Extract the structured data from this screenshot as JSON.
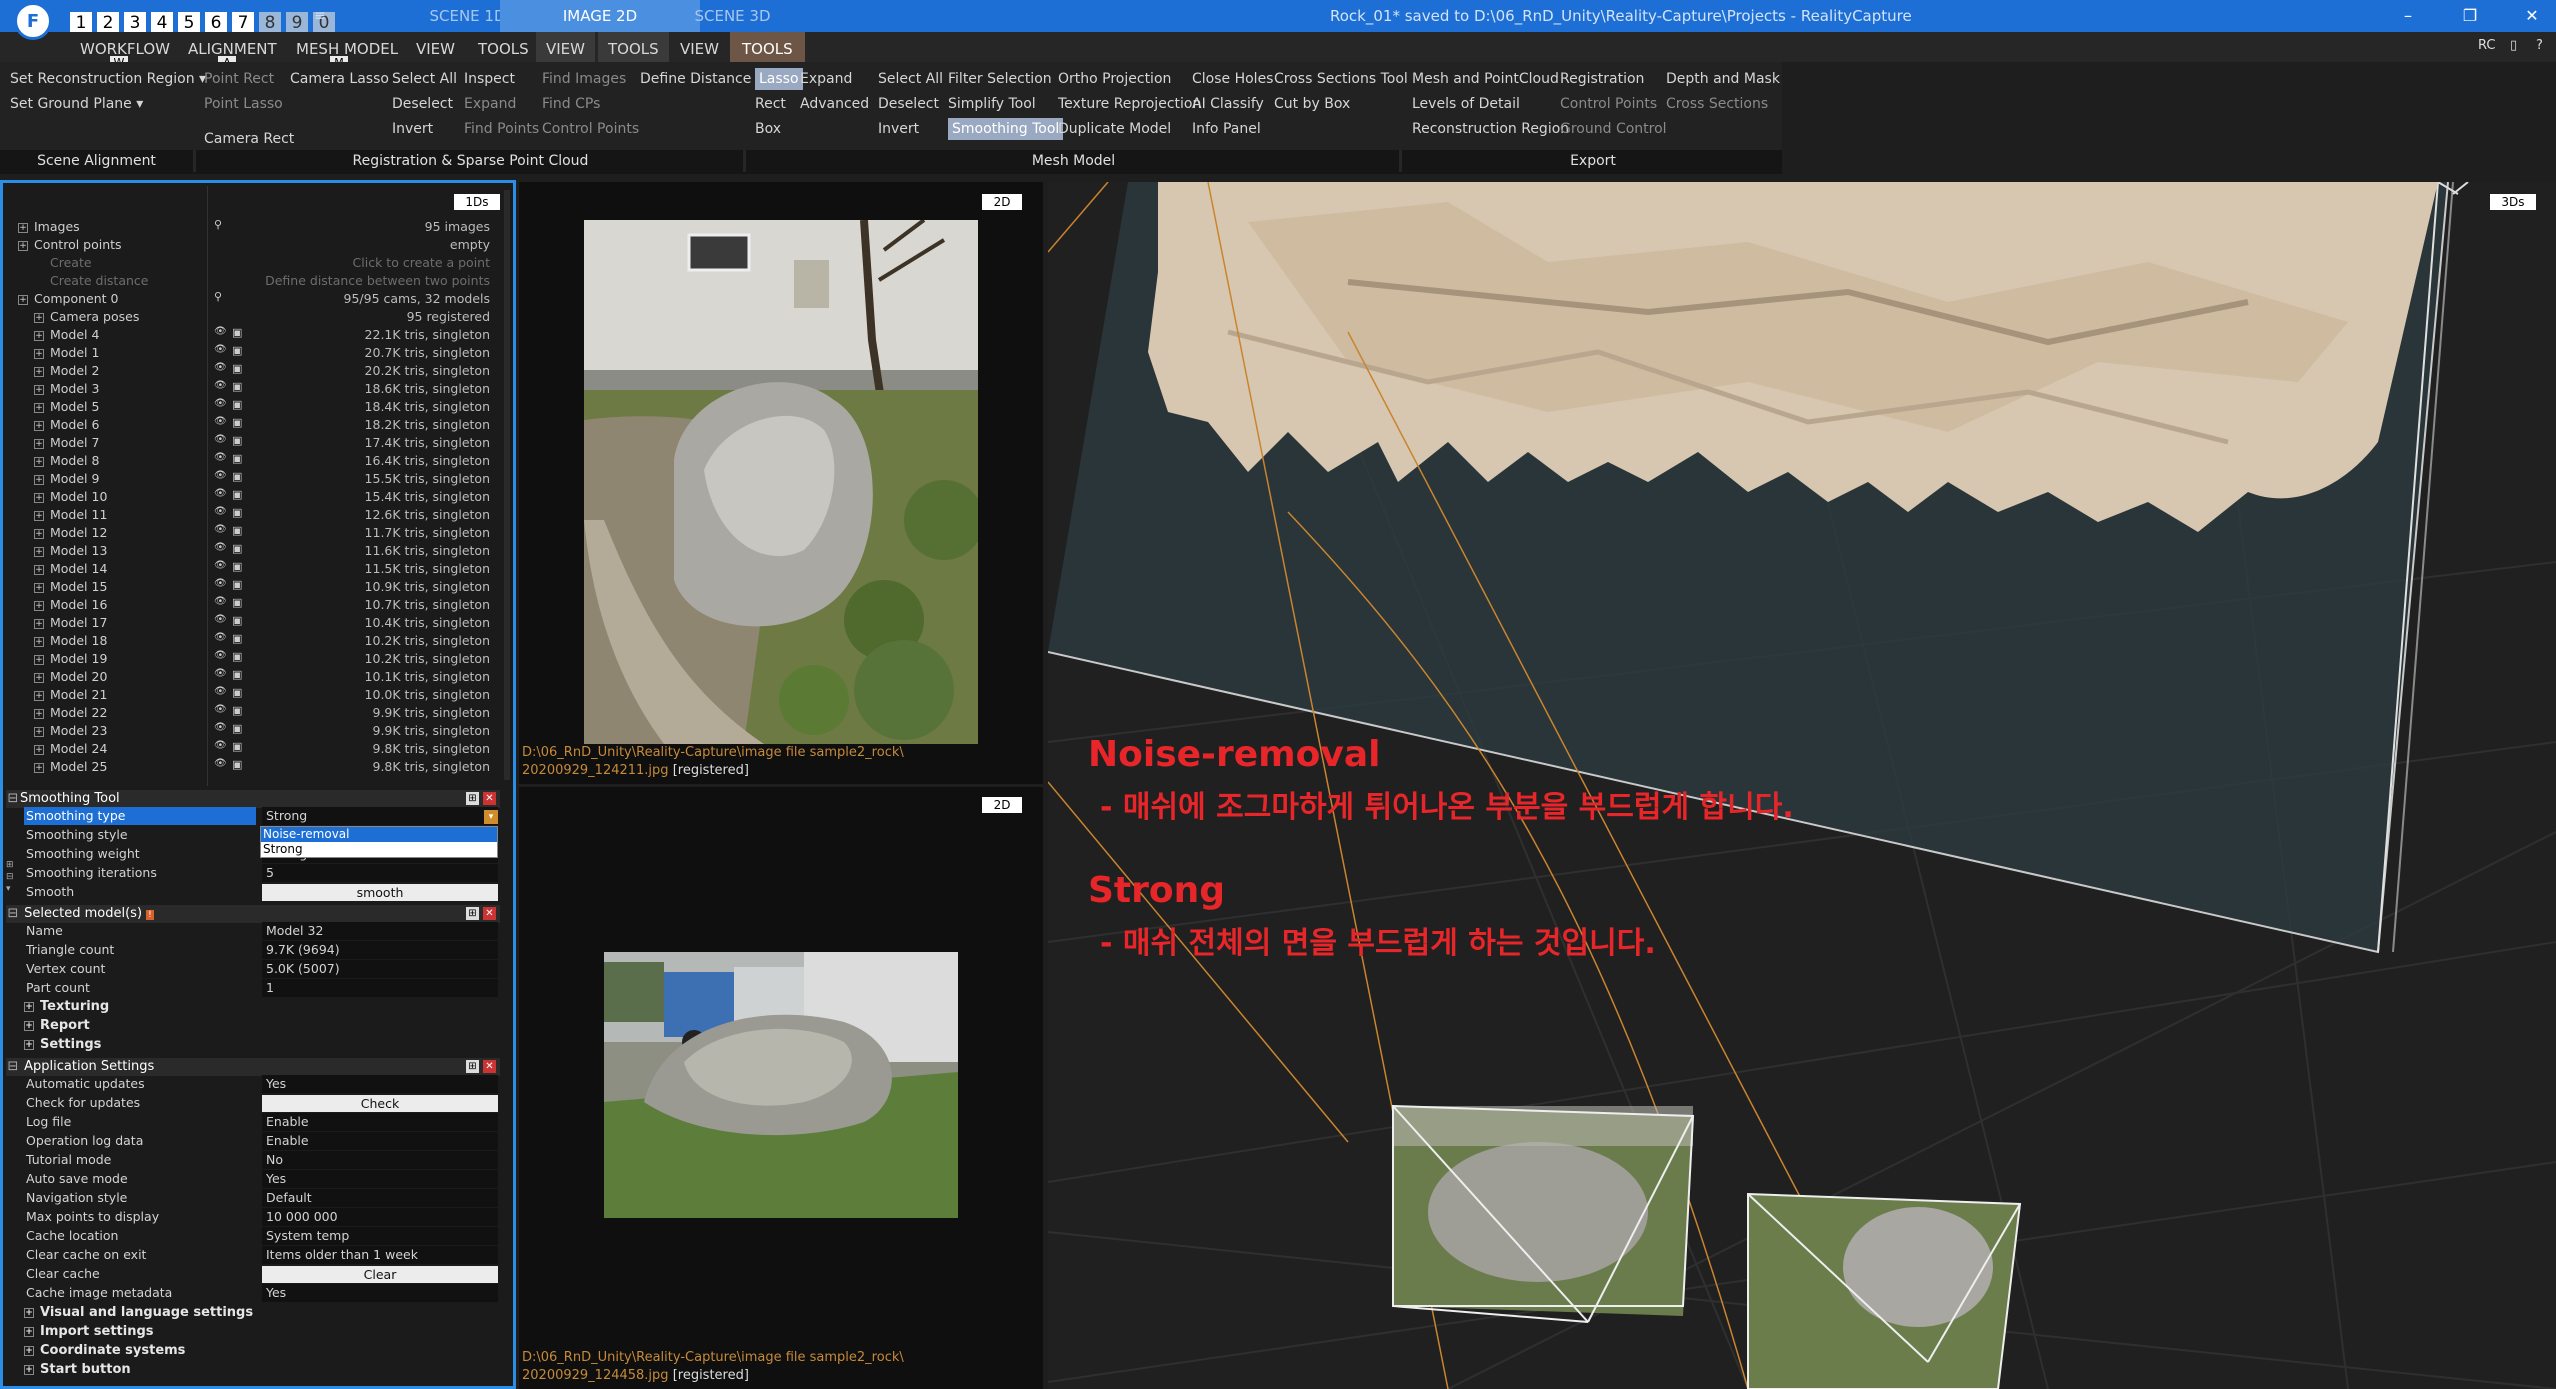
{
  "titlebar": {
    "logo": "F",
    "numkeys": [
      "1",
      "2",
      "3",
      "4",
      "5",
      "6",
      "7",
      "8",
      "9",
      "0"
    ],
    "tabs": [
      "SCENE 1D",
      "IMAGE 2D",
      "SCENE 3D"
    ],
    "title": "Rock_01* saved to D:\\06_RnD_Unity\\Reality-Capture\\Projects - RealityCapture",
    "win_min": "–",
    "win_max": "❐",
    "win_close": "✕",
    "menu_icon": "≡"
  },
  "menu": {
    "items": [
      "WORKFLOW",
      "ALIGNMENT",
      "MESH MODEL",
      "VIEW",
      "TOOLS",
      "VIEW",
      "TOOLS",
      "VIEW",
      "TOOLS"
    ],
    "hotkeys": [
      "W",
      "A",
      "M"
    ],
    "rc_label": "RC"
  },
  "ribbon": {
    "scene_alignment": [
      "Set Reconstruction Region ▾",
      "Set Ground Plane ▾"
    ],
    "reg_col1": [
      "Point Rect",
      "Point Lasso",
      "Camera Rect"
    ],
    "reg_col2": [
      "Camera Lasso"
    ],
    "reg_col3": [
      "Select All",
      "Deselect",
      "Invert"
    ],
    "reg_col4": [
      "Inspect",
      "Expand",
      "Find Points"
    ],
    "reg_col5": [
      "Find Images",
      "Find CPs",
      "Control Points"
    ],
    "reg_col6": [
      "Define Distance"
    ],
    "mesh_col1": [
      "Lasso",
      "Rect",
      "Box"
    ],
    "mesh_col2": [
      "Expand",
      "Advanced"
    ],
    "mesh_col3": [
      "Select All",
      "Deselect",
      "Invert"
    ],
    "mesh_col4": [
      "Filter Selection",
      "Simplify Tool",
      "Smoothing Tool"
    ],
    "mesh_col5": [
      "Ortho Projection",
      "Texture Reprojection",
      "Duplicate Model"
    ],
    "mesh_col6": [
      "Close Holes",
      "AI Classify",
      "Info Panel"
    ],
    "mesh_col7": [
      "Cross Sections Tool",
      "Cut by Box"
    ],
    "export_col1": [
      "Mesh and PointCloud",
      "Levels of Detail",
      "Reconstruction Region"
    ],
    "export_col2": [
      "Registration",
      "Control Points",
      "Ground Control"
    ],
    "export_col3": [
      "Depth and Mask",
      "Cross Sections"
    ],
    "groups": [
      "Scene Alignment",
      "Registration & Sparse Point Cloud",
      "Mesh Model",
      "Export"
    ]
  },
  "tree": {
    "view_tag": "1Ds",
    "rows": [
      {
        "label": "Images",
        "value": "95 images",
        "level": 0
      },
      {
        "label": "Control points",
        "value": "empty",
        "level": 0
      },
      {
        "label": "Create",
        "value": "Click to create a point",
        "level": 2,
        "dim": true
      },
      {
        "label": "Create distance",
        "value": "Define distance between two points",
        "level": 2,
        "dim": true
      },
      {
        "label": "Component 0",
        "value": "95/95 cams, 32 models",
        "level": 0
      },
      {
        "label": "Camera poses",
        "value": "95 registered",
        "level": 1
      },
      {
        "label": "Model 4",
        "value": "22.1K tris, singleton",
        "level": 1
      },
      {
        "label": "Model 1",
        "value": "20.7K tris, singleton",
        "level": 1
      },
      {
        "label": "Model 2",
        "value": "20.2K tris, singleton",
        "level": 1
      },
      {
        "label": "Model 3",
        "value": "18.6K tris, singleton",
        "level": 1
      },
      {
        "label": "Model 5",
        "value": "18.4K tris, singleton",
        "level": 1
      },
      {
        "label": "Model 6",
        "value": "18.2K tris, singleton",
        "level": 1
      },
      {
        "label": "Model 7",
        "value": "17.4K tris, singleton",
        "level": 1
      },
      {
        "label": "Model 8",
        "value": "16.4K tris, singleton",
        "level": 1
      },
      {
        "label": "Model 9",
        "value": "15.5K tris, singleton",
        "level": 1
      },
      {
        "label": "Model 10",
        "value": "15.4K tris, singleton",
        "level": 1
      },
      {
        "label": "Model 11",
        "value": "12.6K tris, singleton",
        "level": 1
      },
      {
        "label": "Model 12",
        "value": "11.7K tris, singleton",
        "level": 1
      },
      {
        "label": "Model 13",
        "value": "11.6K tris, singleton",
        "level": 1
      },
      {
        "label": "Model 14",
        "value": "11.5K tris, singleton",
        "level": 1
      },
      {
        "label": "Model 15",
        "value": "10.9K tris, singleton",
        "level": 1
      },
      {
        "label": "Model 16",
        "value": "10.7K tris, singleton",
        "level": 1
      },
      {
        "label": "Model 17",
        "value": "10.4K tris, singleton",
        "level": 1
      },
      {
        "label": "Model 18",
        "value": "10.2K tris, singleton",
        "level": 1
      },
      {
        "label": "Model 19",
        "value": "10.2K tris, singleton",
        "level": 1
      },
      {
        "label": "Model 20",
        "value": "10.1K tris, singleton",
        "level": 1
      },
      {
        "label": "Model 21",
        "value": "10.0K tris, singleton",
        "level": 1
      },
      {
        "label": "Model 22",
        "value": "9.9K tris, singleton",
        "level": 1
      },
      {
        "label": "Model 23",
        "value": "9.9K tris, singleton",
        "level": 1
      },
      {
        "label": "Model 24",
        "value": "9.8K tris, singleton",
        "level": 1
      },
      {
        "label": "Model 25",
        "value": "9.8K tris, singleton",
        "level": 1
      }
    ]
  },
  "smoothing": {
    "title": "Smoothing Tool",
    "rows": [
      {
        "label": "Smoothing type",
        "value": "Strong"
      },
      {
        "label": "Smoothing style",
        "value": "Noise-removal"
      },
      {
        "label": "Smoothing weight",
        "value": "Strong"
      },
      {
        "label": "Smoothing iterations",
        "value": "5"
      },
      {
        "label": "Smooth",
        "value": "smooth"
      }
    ]
  },
  "selected": {
    "title": "Selected model(s)",
    "rows": [
      {
        "label": "Name",
        "value": "Model 32"
      },
      {
        "label": "Triangle count",
        "value": "9.7K (9694)"
      },
      {
        "label": "Vertex count",
        "value": "5.0K (5007)"
      },
      {
        "label": "Part count",
        "value": "1"
      }
    ],
    "sections": [
      "Texturing",
      "Report",
      "Settings"
    ]
  },
  "appsettings": {
    "title": "Application Settings",
    "rows": [
      {
        "label": "Automatic updates",
        "value": "Yes"
      },
      {
        "label": "Check for updates",
        "value": "Check",
        "button": true
      },
      {
        "label": "Log file",
        "value": "Enable"
      },
      {
        "label": "Operation log data",
        "value": "Enable"
      },
      {
        "label": "Tutorial mode",
        "value": "No"
      },
      {
        "label": "Auto save mode",
        "value": "Yes"
      },
      {
        "label": "Navigation style",
        "value": "Default"
      },
      {
        "label": "Max points to display",
        "value": "10 000 000"
      },
      {
        "label": "Cache location",
        "value": "System temp"
      },
      {
        "label": "Clear cache on exit",
        "value": "Items older than 1 week"
      },
      {
        "label": "Clear cache",
        "value": "Clear",
        "button": true
      },
      {
        "label": "Cache image metadata",
        "value": "Yes"
      }
    ],
    "sections": [
      "Visual and language settings",
      "Import settings",
      "Coordinate systems",
      "Start button"
    ]
  },
  "views": {
    "top": {
      "tag": "2D",
      "path": "D:\\06_RnD_Unity\\Reality-Capture\\image file sample2_rock\\",
      "file": "20200929_124211.jpg",
      "status": "[registered]"
    },
    "bottom": {
      "tag": "2D",
      "path": "D:\\06_RnD_Unity\\Reality-Capture\\image file sample2_rock\\",
      "file": "20200929_124458.jpg",
      "status": "[registered]"
    },
    "view3d_tag": "3Ds"
  },
  "annotations": {
    "title1": "Noise-removal",
    "text1": "- 매쉬에 조그마하게 튀어나온 부분을 부드럽게 합니다.",
    "title2": "Strong",
    "text2": "- 매쉬 전체의 면을 부드럽게 하는 것입니다.",
    "color": "#e8262a"
  },
  "colors": {
    "accent": "#1d6fd6",
    "selection": "#2b8fe8",
    "orange": "#c58a3a"
  }
}
